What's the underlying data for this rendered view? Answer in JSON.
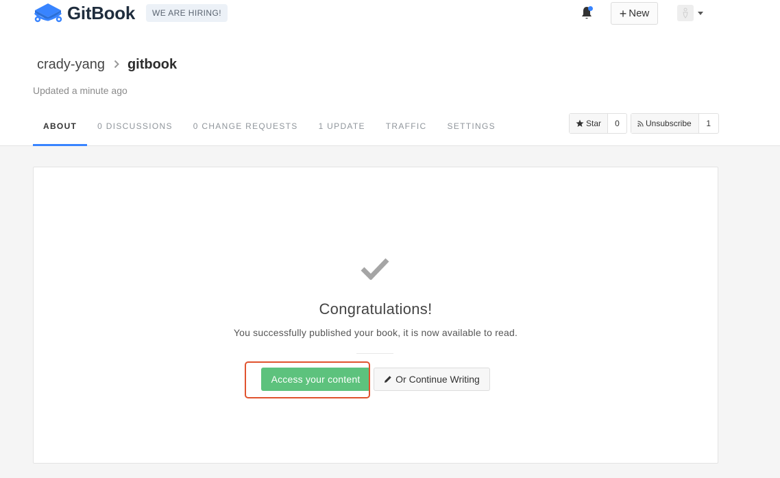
{
  "header": {
    "brand": "GitBook",
    "hiring_badge": "WE ARE HIRING!",
    "new_button": "New",
    "icons": {
      "logo": "gitbook-logo-icon",
      "notifications": "bell-icon",
      "new": "plus-icon",
      "avatar": "user-avatar-icon",
      "menu": "caret-down-icon"
    },
    "notification_dot_color": "#3884ff"
  },
  "breadcrumb": {
    "owner": "crady-yang",
    "separator": ">",
    "book": "gitbook"
  },
  "updated_text": "Updated a minute ago",
  "tabs": [
    {
      "label": "ABOUT",
      "active": true
    },
    {
      "label": "0 DISCUSSIONS",
      "active": false
    },
    {
      "label": "0 CHANGE REQUESTS",
      "active": false
    },
    {
      "label": "1 UPDATE",
      "active": false
    },
    {
      "label": "TRAFFIC",
      "active": false
    },
    {
      "label": "SETTINGS",
      "active": false
    }
  ],
  "actions": {
    "star_label": "Star",
    "star_count": "0",
    "unsubscribe_label": "Unsubscribe",
    "unsubscribe_count": "1"
  },
  "main": {
    "title": "Congratulations!",
    "message": "You successfully published your book, it is now available to read.",
    "primary_button": "Access your content",
    "secondary_button": "Or Continue Writing",
    "icons": {
      "success": "checkmark-icon",
      "secondary": "pencil-icon",
      "star": "star-icon",
      "rss": "rss-icon"
    }
  },
  "colors": {
    "accent": "#3884ff",
    "primary_button": "#5dc27d",
    "highlight_border": "#e0522d"
  }
}
